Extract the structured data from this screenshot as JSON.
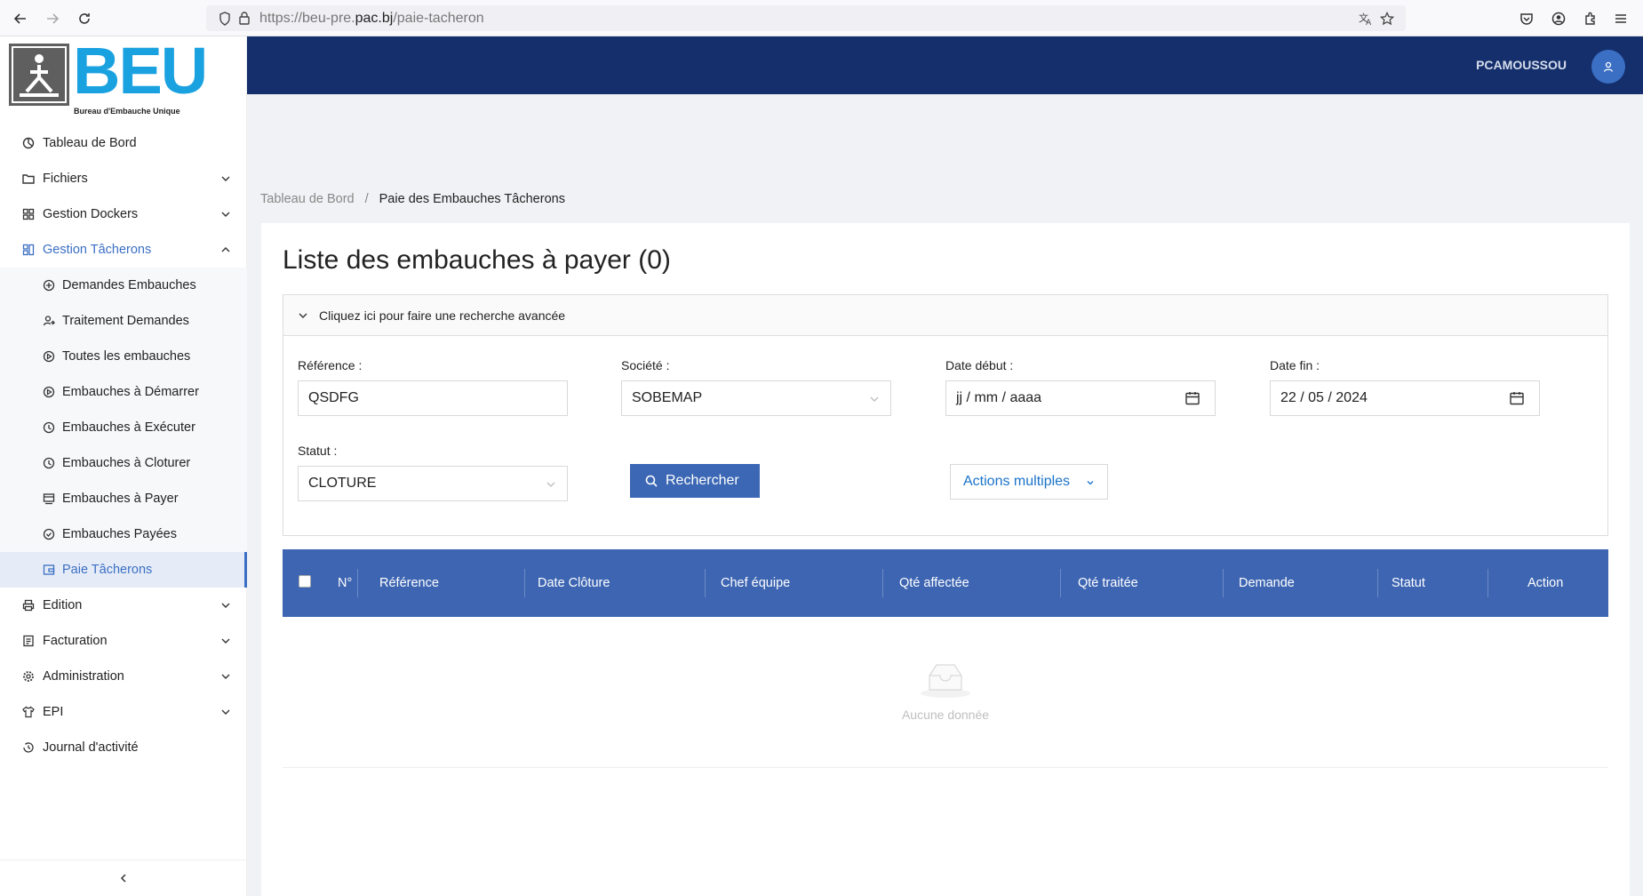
{
  "browser": {
    "url_prefix": "https://beu-pre.",
    "url_domain": "pac.bj",
    "url_path": "/paie-tacheron"
  },
  "logo": {
    "text": "BEU",
    "subtitle": "Bureau d'Embauche Unique"
  },
  "header": {
    "user": "PCAMOUSSOU"
  },
  "sidebar": {
    "items": [
      {
        "label": "Tableau de Bord"
      },
      {
        "label": "Fichiers"
      },
      {
        "label": "Gestion Dockers"
      },
      {
        "label": "Gestion Tâcherons"
      },
      {
        "label": "Demandes Embauches"
      },
      {
        "label": "Traitement Demandes"
      },
      {
        "label": "Toutes les embauches"
      },
      {
        "label": "Embauches à Démarrer"
      },
      {
        "label": "Embauches à Exécuter"
      },
      {
        "label": "Embauches à Cloturer"
      },
      {
        "label": "Embauches à Payer"
      },
      {
        "label": "Embauches Payées"
      },
      {
        "label": "Paie Tâcherons"
      },
      {
        "label": "Edition"
      },
      {
        "label": "Facturation"
      },
      {
        "label": "Administration"
      },
      {
        "label": "EPI"
      },
      {
        "label": "Journal d'activité"
      }
    ]
  },
  "breadcrumb": {
    "home": "Tableau de Bord",
    "separator": "/",
    "current": "Paie des Embauches Tâcherons"
  },
  "main": {
    "title": "Liste des embauches à payer (0)",
    "search_toggle": "Cliquez ici pour faire une recherche avancée",
    "fields": {
      "reference_label": "Référence :",
      "reference_value": "QSDFG",
      "societe_label": "Société :",
      "societe_value": "SOBEMAP",
      "date_debut_label": "Date début :",
      "date_debut_value": "jj / mm / aaaa",
      "date_fin_label": "Date fin :",
      "date_fin_value": "22 / 05 / 2024",
      "statut_label": "Statut :",
      "statut_value": "CLOTURE"
    },
    "search_button": "Rechercher",
    "actions_button": "Actions multiples"
  },
  "table": {
    "columns": [
      "N°",
      "Référence",
      "Date Clôture",
      "Chef équipe",
      "Qté affectée",
      "Qté traitée",
      "Demande",
      "Statut",
      "Action"
    ],
    "empty_text": "Aucune donnée"
  }
}
